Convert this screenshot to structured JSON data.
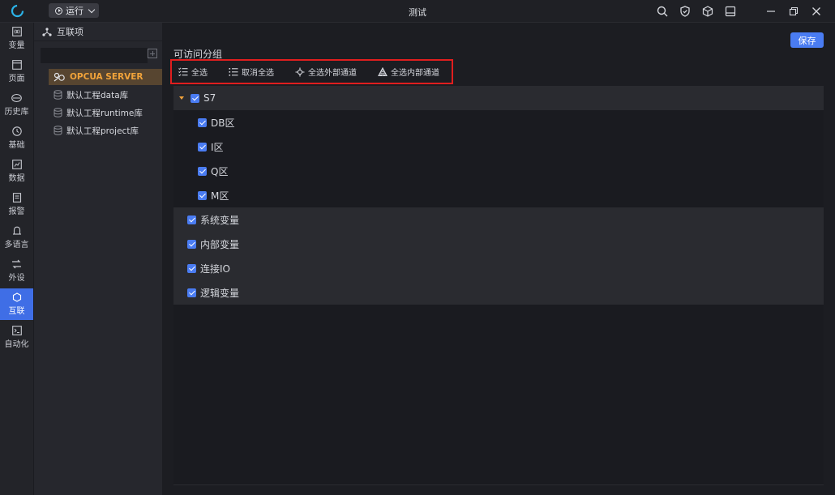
{
  "titlebar": {
    "run_label": "运行",
    "title": "测试"
  },
  "nav": [
    {
      "label": "变量",
      "icon": "variable-icon"
    },
    {
      "label": "页面",
      "icon": "page-icon"
    },
    {
      "label": "历史库",
      "icon": "history-icon"
    },
    {
      "label": "基础",
      "icon": "basic-icon"
    },
    {
      "label": "数据",
      "icon": "data-icon"
    },
    {
      "label": "报警",
      "icon": "alarm-icon"
    },
    {
      "label": "多语言",
      "icon": "language-icon"
    },
    {
      "label": "外设",
      "icon": "peripheral-icon"
    },
    {
      "label": "互联",
      "icon": "interconnect-icon",
      "active": true
    },
    {
      "label": "自动化",
      "icon": "automation-icon"
    }
  ],
  "tree": {
    "header": "互联项",
    "items": [
      {
        "label": "OPCUA SERVER",
        "selected": true
      },
      {
        "label": "默认工程data库"
      },
      {
        "label": "默认工程runtime库"
      },
      {
        "label": "默认工程project库"
      }
    ]
  },
  "main": {
    "save_label": "保存",
    "group_label": "可访问分组",
    "toolbar": {
      "select_all": "全选",
      "deselect_all": "取消全选",
      "select_external": "全选外部通道",
      "select_internal": "全选内部通道"
    },
    "groups": [
      {
        "label": "S7",
        "checked": true,
        "expanded": true,
        "children": [
          {
            "label": "DB区",
            "checked": true
          },
          {
            "label": "I区",
            "checked": true
          },
          {
            "label": "Q区",
            "checked": true
          },
          {
            "label": "M区",
            "checked": true
          }
        ]
      },
      {
        "label": "系统变量",
        "checked": true
      },
      {
        "label": "内部变量",
        "checked": true
      },
      {
        "label": "连接IO",
        "checked": true
      },
      {
        "label": "逻辑变量",
        "checked": true
      }
    ]
  },
  "colors": {
    "accent": "#4a7cf2",
    "highlight_border": "#e01e1e",
    "selected_text": "#f1a33a"
  }
}
